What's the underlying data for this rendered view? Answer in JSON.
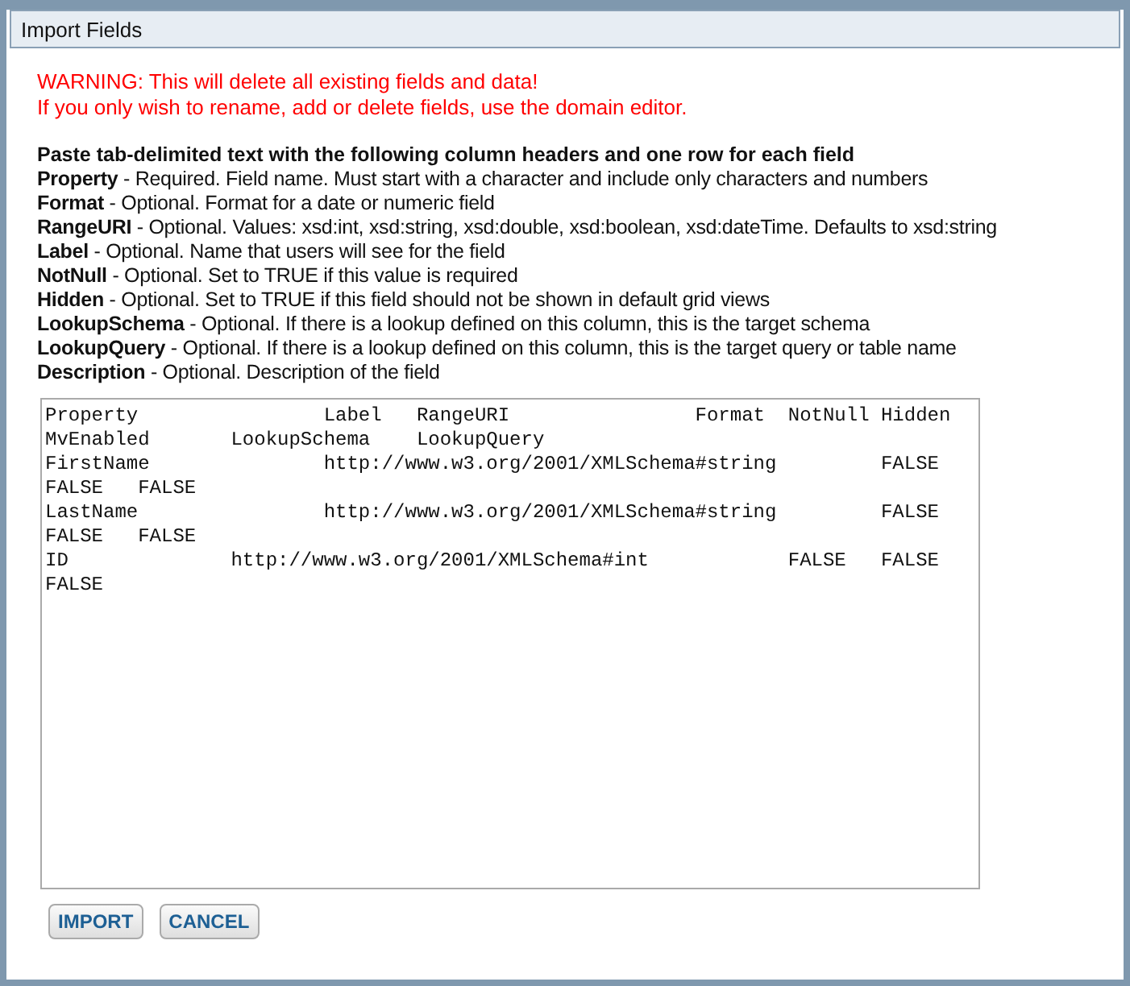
{
  "dialog": {
    "title": "Import Fields"
  },
  "warnings": [
    "WARNING: This will delete all existing fields and data!",
    "If you only wish to rename, add or delete fields, use the domain editor."
  ],
  "instructions": {
    "heading": "Paste tab-delimited text with the following column headers and one row for each field",
    "fields": [
      "**Property** - Required. Field name. Must start with a character and include only characters and numbers",
      "**Format** - Optional. Format for a date or numeric field",
      "**RangeURI** - Optional. Values: xsd:int, xsd:string, xsd:double, xsd:boolean, xsd:dateTime. Defaults to xsd:string",
      "**Label** - Optional. Name that users will see for the field",
      "**NotNull** - Optional. Set to TRUE if this value is required",
      "**Hidden** - Optional. Set to TRUE if this field should not be shown in default grid views",
      "**LookupSchema** - Optional. If there is a lookup defined on this column, this is the target schema",
      "**LookupQuery** - Optional. If there is a lookup defined on this column, this is the target query or table name",
      "**Description** - Optional. Description of the field"
    ]
  },
  "paste_area": {
    "value": "Property\t\tLabel\tRangeURI\t\tFormat\tNotNull\tHidden\tMvEnabled\tLookupSchema\tLookupQuery\nFirstName\t\thttp://www.w3.org/2001/XMLSchema#string\t\tFALSE\tFALSE\tFALSE\nLastName\t\thttp://www.w3.org/2001/XMLSchema#string\t\tFALSE\tFALSE\tFALSE\nID\t\thttp://www.w3.org/2001/XMLSchema#int\t\tFALSE\tFALSE\tFALSE"
  },
  "buttons": [
    "IMPORT",
    "CANCEL"
  ]
}
